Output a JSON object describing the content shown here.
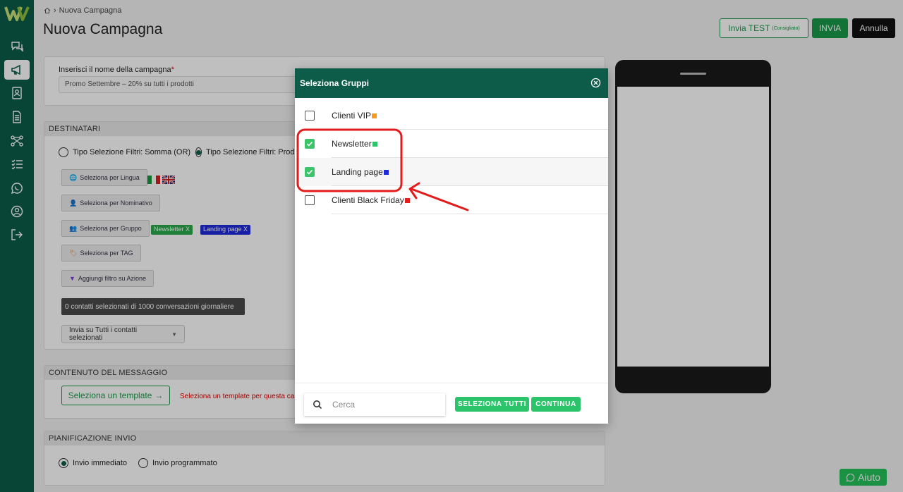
{
  "colors": {
    "brand": "#0d5c4a",
    "accent": "#1a9a4a",
    "annotation": "#e31b1b"
  },
  "breadcrumb": {
    "home_icon": "home-icon",
    "current": "Nuova Campagna"
  },
  "page": {
    "title": "Nuova Campagna"
  },
  "header_actions": {
    "test_label": "Invia TEST",
    "test_note": "(Consigliato)",
    "send_label": "INVIA",
    "cancel_label": "Annulla"
  },
  "sidebar": {
    "items": [
      {
        "icon": "chat-icon"
      },
      {
        "icon": "megaphone-icon",
        "active": true
      },
      {
        "icon": "contacts-icon"
      },
      {
        "icon": "document-icon"
      },
      {
        "icon": "flow-icon"
      },
      {
        "icon": "checklist-icon"
      },
      {
        "icon": "whatsapp-icon"
      },
      {
        "icon": "account-icon"
      },
      {
        "icon": "logout-icon"
      }
    ]
  },
  "campaign_name": {
    "label": "Inserisci il nome della campagna",
    "required_mark": "*",
    "value": "Promo Settembre – 20% su tutti i prodotti"
  },
  "recipients": {
    "section_title": "DESTINATARI",
    "filter_mode_or": "Tipo Selezione Filtri: Somma (OR)",
    "filter_mode_and": "Tipo Selezione Filtri: Prodotto (AND)",
    "by_language": "Seleziona per Lingua",
    "by_name": "Seleziona per Nominativo",
    "by_group": "Seleziona per Gruppo",
    "by_tag": "Seleziona per TAG",
    "by_action": "Aggiungi filtro su Azione",
    "group_tags": [
      "Newsletter X",
      "Landing page X"
    ],
    "count_text": "0 contatti selezionati di 1000 conversazioni giornaliere",
    "send_select": "Invia su Tutti i contatti selezionati"
  },
  "message": {
    "section_title": "CONTENUTO DEL MESSAGGIO",
    "template_button": "Seleziona un template",
    "template_hint": "Seleziona un template per questa campagna"
  },
  "schedule": {
    "section_title": "PIANIFICAZIONE INVIO",
    "immediate": "Invio immediato",
    "scheduled": "Invio programmato"
  },
  "modal": {
    "title": "Seleziona Gruppi",
    "groups": [
      {
        "label": "Clienti VIP",
        "color": "#f39a1f",
        "checked": false
      },
      {
        "label": "Newsletter",
        "color": "#2bc46a",
        "checked": true
      },
      {
        "label": "Landing page",
        "color": "#1f2bd8",
        "checked": true
      },
      {
        "label": "Clienti Black Friday",
        "color": "#e32020",
        "checked": false
      }
    ],
    "search_placeholder": "Cerca",
    "select_all": "SELEZIONA TUTTI",
    "continue": "CONTINUA"
  },
  "help": {
    "label": "Aiuto"
  }
}
